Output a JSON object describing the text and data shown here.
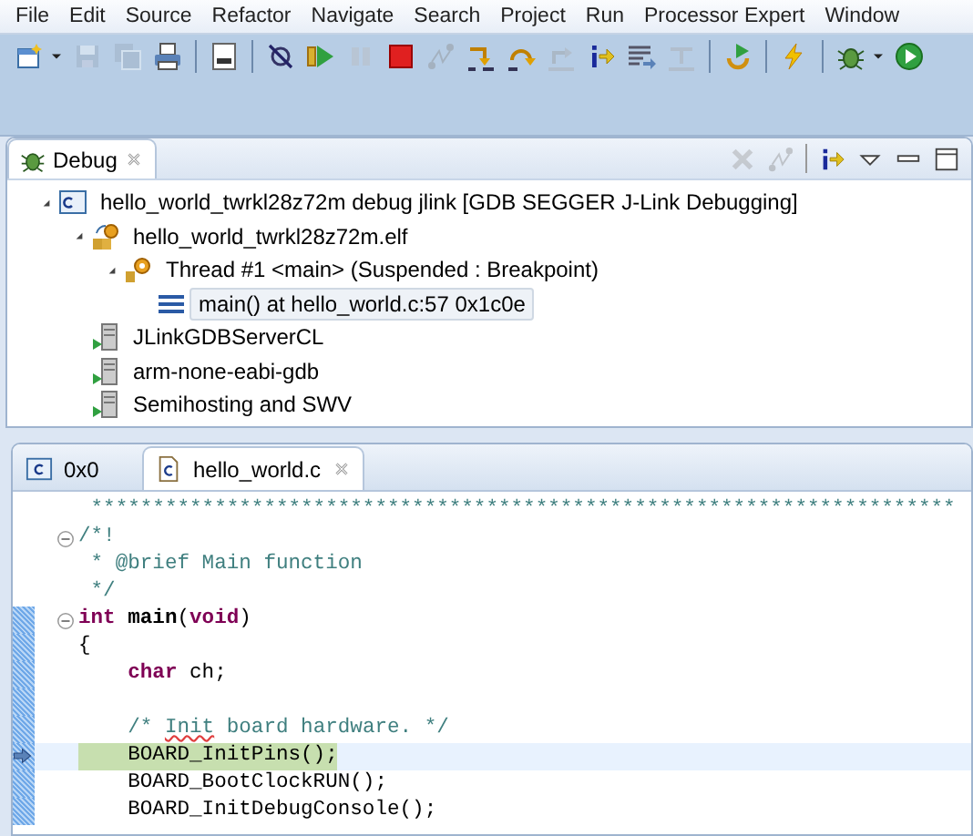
{
  "menu_bar": [
    "File",
    "Edit",
    "Source",
    "Refactor",
    "Navigate",
    "Search",
    "Project",
    "Run",
    "Processor Expert",
    "Window"
  ],
  "toolbar": [
    {
      "kind": "new",
      "disabled": false
    },
    {
      "kind": "dropdown",
      "disabled": false
    },
    {
      "kind": "save",
      "disabled": true
    },
    {
      "kind": "save-all",
      "disabled": true
    },
    {
      "kind": "print",
      "disabled": false
    },
    {
      "kind": "separator"
    },
    {
      "kind": "binary",
      "disabled": false
    },
    {
      "kind": "separator"
    },
    {
      "kind": "skip-breakpoints",
      "disabled": false
    },
    {
      "kind": "resume",
      "disabled": false
    },
    {
      "kind": "suspend",
      "disabled": true
    },
    {
      "kind": "terminate",
      "disabled": false
    },
    {
      "kind": "disconnect",
      "disabled": true
    },
    {
      "kind": "step-into",
      "disabled": false
    },
    {
      "kind": "step-over",
      "disabled": false
    },
    {
      "kind": "step-return",
      "disabled": true
    },
    {
      "kind": "instruction-step",
      "disabled": false
    },
    {
      "kind": "lines",
      "disabled": false
    },
    {
      "kind": "step-filters",
      "disabled": true
    },
    {
      "kind": "separator"
    },
    {
      "kind": "restart",
      "disabled": false
    },
    {
      "kind": "separator"
    },
    {
      "kind": "flash",
      "disabled": false
    },
    {
      "kind": "separator"
    },
    {
      "kind": "debug",
      "disabled": false
    },
    {
      "kind": "dropdown",
      "disabled": false
    },
    {
      "kind": "run",
      "disabled": false
    }
  ],
  "debug_view": {
    "tab": {
      "label": "Debug"
    },
    "actions": [
      {
        "kind": "remove",
        "disabled": true
      },
      {
        "kind": "disconnect",
        "disabled": true
      },
      {
        "kind": "separator"
      },
      {
        "kind": "instruction-step",
        "disabled": false
      },
      {
        "kind": "view-menu",
        "disabled": false
      },
      {
        "kind": "minimize",
        "disabled": false
      },
      {
        "kind": "maximize",
        "disabled": false
      }
    ],
    "tree": [
      {
        "kind": "launch",
        "label": "hello_world_twrkl28z72m debug jlink [GDB SEGGER J-Link Debugging]",
        "expanded": true,
        "selected": false,
        "children": [
          {
            "kind": "process",
            "label": "hello_world_twrkl28z72m.elf",
            "expanded": true,
            "selected": false,
            "children": [
              {
                "kind": "thread",
                "label": "Thread #1 <main> (Suspended : Breakpoint)",
                "expanded": true,
                "selected": false,
                "children": [
                  {
                    "kind": "frame",
                    "label": "main() at hello_world.c:57 0x1c0e",
                    "selected": true
                  }
                ]
              }
            ]
          },
          {
            "kind": "program",
            "label": "JLinkGDBServerCL",
            "selected": false
          },
          {
            "kind": "program",
            "label": "arm-none-eabi-gdb",
            "selected": false
          },
          {
            "kind": "program",
            "label": "Semihosting and SWV",
            "selected": false
          }
        ]
      }
    ]
  },
  "editor": {
    "tabs": [
      {
        "label": "0x0",
        "kind": "disassembly",
        "selected": false,
        "closable": false
      },
      {
        "label": "hello_world.c",
        "kind": "source",
        "selected": true,
        "closable": true
      }
    ],
    "lines": [
      {
        "fold": false,
        "changed": false,
        "current": false,
        "segments": [
          {
            "kind": "comment",
            "text": " **********************************************************************"
          }
        ]
      },
      {
        "fold": true,
        "changed": false,
        "current": false,
        "segments": [
          {
            "kind": "comment",
            "text": "/*!"
          }
        ]
      },
      {
        "fold": false,
        "changed": false,
        "current": false,
        "segments": [
          {
            "kind": "comment",
            "text": " * @brief Main function"
          }
        ]
      },
      {
        "fold": false,
        "changed": false,
        "current": false,
        "segments": [
          {
            "kind": "comment",
            "text": " */"
          }
        ]
      },
      {
        "fold": true,
        "changed": true,
        "current": false,
        "segments": [
          {
            "kind": "keyword",
            "text": "int"
          },
          {
            "kind": "bold",
            "text": " main"
          },
          {
            "kind": "plain",
            "text": "("
          },
          {
            "kind": "keyword",
            "text": "void"
          },
          {
            "kind": "plain",
            "text": ")"
          }
        ]
      },
      {
        "fold": false,
        "changed": true,
        "current": false,
        "segments": [
          {
            "kind": "plain",
            "text": "{"
          }
        ]
      },
      {
        "fold": false,
        "changed": true,
        "current": false,
        "segments": [
          {
            "kind": "keyword",
            "text": "    char"
          },
          {
            "kind": "plain",
            "text": " ch;"
          }
        ]
      },
      {
        "fold": false,
        "changed": true,
        "current": false
      },
      {
        "fold": false,
        "changed": true,
        "current": false,
        "segments": [
          {
            "kind": "comment",
            "text": "    /* "
          },
          {
            "kind": "misspelled",
            "text": "Init"
          },
          {
            "kind": "comment",
            "text": " board hardware. */"
          }
        ]
      },
      {
        "fold": false,
        "changed": true,
        "current": true,
        "segments": [
          {
            "kind": "plain",
            "text": "    BOARD_InitPins();"
          }
        ]
      },
      {
        "fold": false,
        "changed": true,
        "current": false,
        "segments": [
          {
            "kind": "plain",
            "text": "    BOARD_BootClockRUN();"
          }
        ]
      },
      {
        "fold": false,
        "changed": true,
        "current": false,
        "segments": [
          {
            "kind": "plain",
            "text": "    BOARD_InitDebugConsole();"
          }
        ]
      }
    ]
  }
}
